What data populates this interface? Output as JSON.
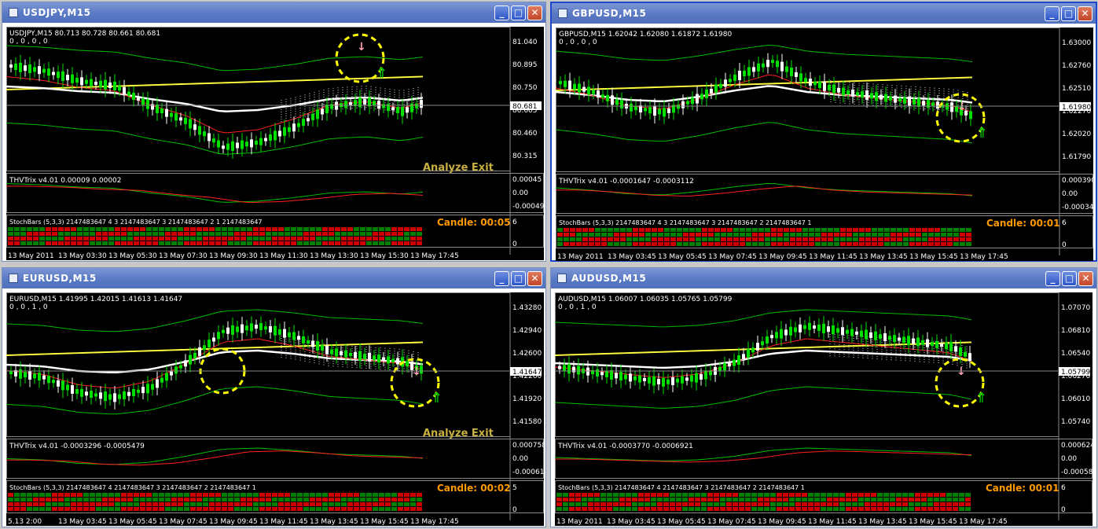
{
  "windows": [
    {
      "title": "USDJPY,M15",
      "main_title": "USDJPY,M15  80.713 80.728 80.661 80.681",
      "main_sub": "0 , 0 , 0 , 0",
      "price_ticks": [
        "81.040",
        "80.895",
        "80.750",
        "80.605",
        "80.460",
        "80.315"
      ],
      "current_price": "80.681",
      "trix_title": "THVTrix v4.01 0.00009 0.00002",
      "trix_ticks": [
        "0.00045",
        "0.00",
        "-0.00049"
      ],
      "stoch_title": "StochBars (5,3,3) 2147483647 4 3 2147483647 3 2147483647 2 1 2147483647",
      "stoch_ticks": [
        "6",
        "0"
      ],
      "candle_label": "Candle:  00:05",
      "overlay_text": "Analyze Exit",
      "time_axis": [
        "13 May 2011",
        "13 May 03:30",
        "13 May 05:30",
        "13 May 07:30",
        "13 May 09:30",
        "13 May 11:30",
        "13 May 13:30",
        "13 May 15:30",
        "13 May 17:45"
      ]
    },
    {
      "title": "GBPUSD,M15",
      "main_title": "GBPUSD,M15  1.62042 1.62080 1.61872 1.61980",
      "main_sub": "0 , 0 , 0 , 0",
      "price_ticks": [
        "1.63000",
        "1.62760",
        "1.62510",
        "1.62270",
        "1.62020",
        "1.61790"
      ],
      "current_price": "1.61980",
      "trix_title": "THVTrix v4.01 -0.0001647 -0.0003112",
      "trix_ticks": [
        "0.000390",
        "0.00",
        "-0.000346"
      ],
      "stoch_title": "StochBars (5,3,3) 2147483647 4 3 2147483647 3 2147483647 2 2147483647 1",
      "stoch_ticks": [
        "6",
        "0"
      ],
      "candle_label": "Candle:  00:01",
      "overlay_text": "",
      "time_axis": [
        "13 May 2011",
        "13 May 03:45",
        "13 May 05:45",
        "13 May 07:45",
        "13 May 09:45",
        "13 May 11:45",
        "13 May 13:45",
        "13 May 15:45",
        "13 May 17:45"
      ]
    },
    {
      "title": "EURUSD,M15",
      "main_title": "EURUSD,M15  1.41995 1.42015 1.41613 1.41647",
      "main_sub": "0 , 0 , 1 , 0",
      "price_ticks": [
        "1.43280",
        "1.42940",
        "1.42600",
        "1.42260",
        "1.41920",
        "1.41580"
      ],
      "current_price": "1.41647",
      "trix_title": "THVTrix v4.01 -0.0003296 -0.0005479",
      "trix_ticks": [
        "0.000758",
        "0.00",
        "-0.00061"
      ],
      "stoch_title": "StochBars (5,3,3) 2147483647 4 2147483647 3 2147483647 2 2147483647 1",
      "stoch_ticks": [
        "5",
        "0"
      ],
      "candle_label": "Candle:  00:02",
      "overlay_text": "Analyze Exit",
      "time_axis": [
        "5.13 2:00",
        "13 May 03:45",
        "13 May 05:45",
        "13 May 07:45",
        "13 May 09:45",
        "13 May 11:45",
        "13 May 13:45",
        "13 May 15:45",
        "13 May 17:45"
      ]
    },
    {
      "title": "AUDUSD,M15",
      "main_title": "AUDUSD,M15  1.06007 1.06035 1.05765 1.05799",
      "main_sub": "0 , 0 , 1 , 0",
      "price_ticks": [
        "1.07070",
        "1.06810",
        "1.06540",
        "1.06270",
        "1.06010",
        "1.05740"
      ],
      "current_price": "1.05799",
      "trix_title": "THVTrix v4.01 -0.0003770 -0.0006921",
      "trix_ticks": [
        "0.000624",
        "0.00",
        "-0.000586"
      ],
      "stoch_title": "StochBars (5,3,3) 2147483647 4 2147483647 3 2147483647 2 2147483647 1",
      "stoch_ticks": [
        "6",
        "0"
      ],
      "candle_label": "Candle:  00:01",
      "overlay_text": "",
      "time_axis": [
        "13 May 2011",
        "13 May 03:45",
        "13 May 05:45",
        "13 May 07:45",
        "13 May 09:45",
        "13 May 11:45",
        "13 May 13:45",
        "13 May 15:45",
        "13 May 17:45"
      ]
    }
  ],
  "colors": {
    "bull_candle": "#00e000",
    "bear_candle": "#ffffff",
    "ma_white": "#ffffff",
    "ma_yellow": "#ffff40",
    "ma_orange": "#e07a20",
    "signal_red": "#ff2020",
    "channel_green": "#00c000",
    "highlight_circle": "#ffff00",
    "candle_label": "#ff9900"
  },
  "icons": {
    "minimize": "minimize-icon",
    "maximize": "maximize-icon",
    "close": "close-icon",
    "up_signal": "up-arrow-icon",
    "down_signal": "down-arrow-icon"
  }
}
